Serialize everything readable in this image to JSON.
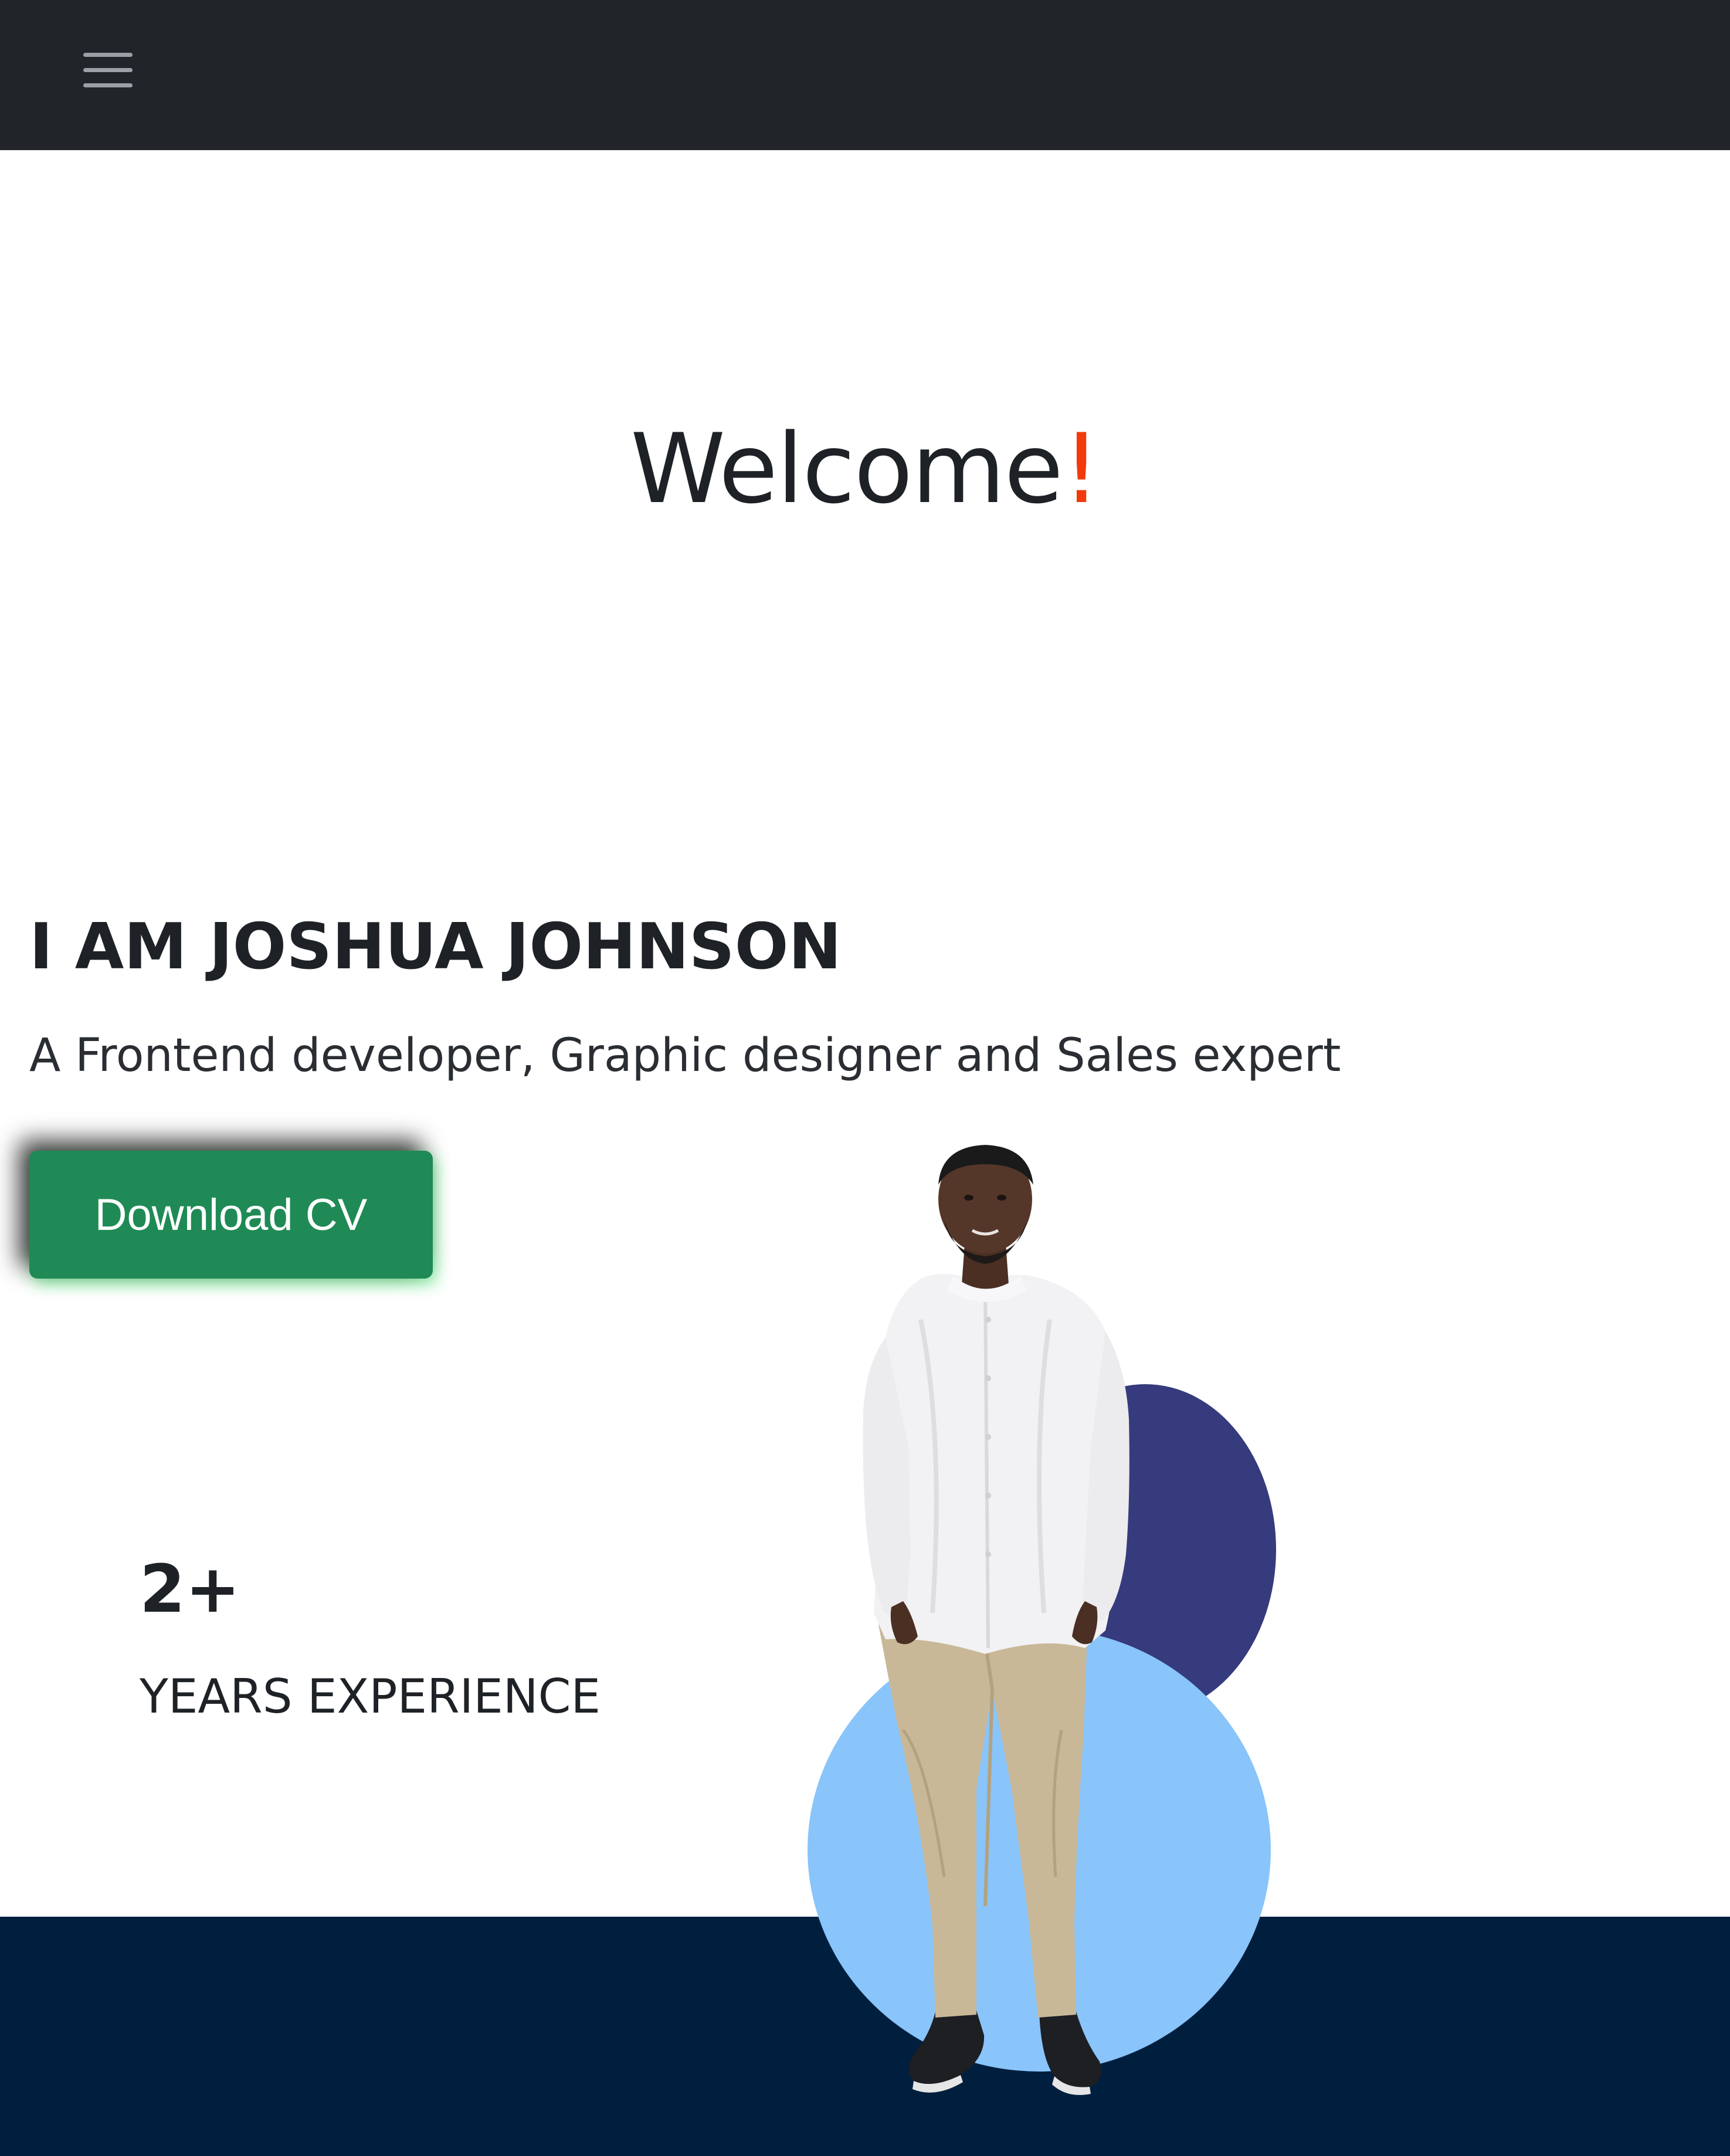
{
  "navbar": {
    "menu_icon": "hamburger-menu-icon"
  },
  "hero": {
    "welcome_text": "Welcome",
    "welcome_mark": "!",
    "name_heading": "I AM JOSHUA JOHNSON",
    "tagline": "A Frontend developer, Graphic designer and Sales expert",
    "download_label": "Download CV"
  },
  "experience": {
    "number": "2+",
    "label": "YEARS EXPERIENCE"
  },
  "colors": {
    "navbar": "#212529",
    "accent_exclamation": "#f23a0c",
    "button": "#1f8a55",
    "circle_dark": "#353b7c",
    "circle_light": "#89c4fa",
    "footer": "#001f3f"
  }
}
